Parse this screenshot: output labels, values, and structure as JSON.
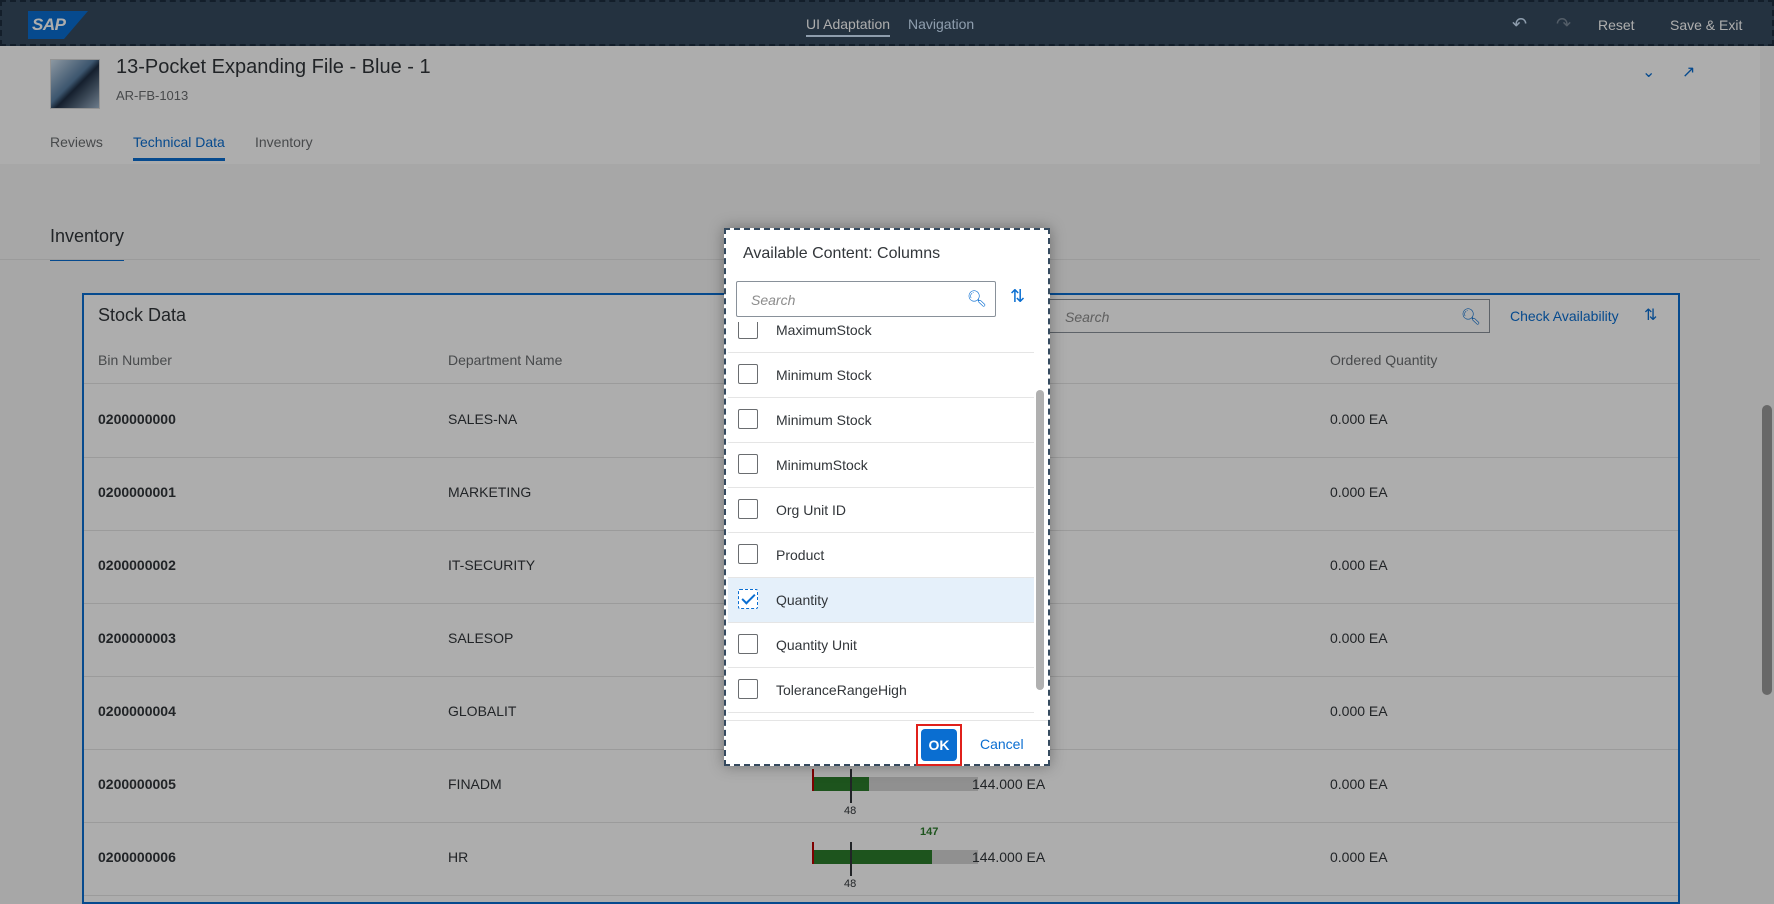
{
  "shell": {
    "logo": "SAP",
    "nav_ui_adaptation": "UI Adaptation",
    "nav_navigation": "Navigation",
    "undo_icon": "undo-icon",
    "redo_icon": "redo-icon",
    "reset": "Reset",
    "save_exit": "Save & Exit"
  },
  "product": {
    "title": "13-Pocket Expanding File - Blue - 1",
    "id": "AR-FB-1013"
  },
  "tabs": [
    "Reviews",
    "Technical Data",
    "Inventory"
  ],
  "section": {
    "title": "Inventory"
  },
  "table": {
    "title": "Stock Data",
    "search_placeholder": "Search",
    "check_availability": "Check Availability",
    "columns": [
      "Bin Number",
      "Department Name",
      "Ordered Quantity"
    ],
    "rows": [
      {
        "bin": "0200000000",
        "dept": "SALES-NA",
        "ordered": "0.000 EA"
      },
      {
        "bin": "0200000001",
        "dept": "MARKETING",
        "ordered": "0.000 EA"
      },
      {
        "bin": "0200000002",
        "dept": "IT-SECURITY",
        "ordered": "0.000 EA"
      },
      {
        "bin": "0200000003",
        "dept": "SALESOP",
        "ordered": "0.000 EA"
      },
      {
        "bin": "0200000004",
        "dept": "GLOBALIT",
        "ordered": "0.000 EA"
      },
      {
        "bin": "0200000005",
        "dept": "FINADM",
        "ordered": "0.000 EA",
        "quantity": "144.000 EA",
        "bar_mark": "48"
      },
      {
        "bin": "0200000006",
        "dept": "HR",
        "ordered": "0.000 EA",
        "quantity": "144.000 EA",
        "bar_mark": "48",
        "bar_top": "147"
      }
    ]
  },
  "dialog": {
    "title": "Available Content: Columns",
    "search_placeholder": "Search",
    "items": [
      {
        "label": "MaximumStock",
        "checked": false
      },
      {
        "label": "Minimum Stock",
        "checked": false
      },
      {
        "label": "Minimum Stock",
        "checked": false
      },
      {
        "label": "MinimumStock",
        "checked": false
      },
      {
        "label": "Org Unit ID",
        "checked": false
      },
      {
        "label": "Product",
        "checked": false
      },
      {
        "label": "Quantity",
        "checked": true
      },
      {
        "label": "Quantity Unit",
        "checked": false
      },
      {
        "label": "ToleranceRangeHigh",
        "checked": false
      }
    ],
    "ok": "OK",
    "cancel": "Cancel"
  }
}
